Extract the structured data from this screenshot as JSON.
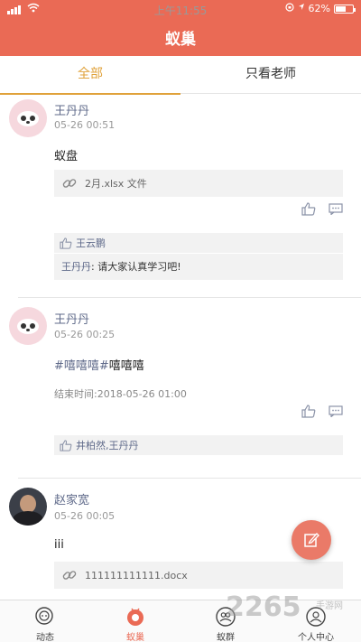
{
  "status_bar": {
    "time": "上午11:55",
    "battery": "62%",
    "battery_level": 0.62
  },
  "header": {
    "title": "蚁巢"
  },
  "tabs": [
    {
      "label": "全部",
      "active": true
    },
    {
      "label": "只看老师",
      "active": false
    }
  ],
  "posts": [
    {
      "author": "王丹丹",
      "time": "05-26 00:51",
      "content": "蚁盘",
      "file": "2月.xlsx 文件",
      "likers": "王云鹏",
      "comment": {
        "author": "王丹丹",
        "sep": ": ",
        "text": "请大家认真学习吧!"
      }
    },
    {
      "author": "王丹丹",
      "time": "05-26 00:25",
      "tag": "#嘻嘻嘻#",
      "content": "嘻嘻嘻",
      "end_time": "结束时间:2018-05-26 01:00",
      "likers": "井柏然,王丹丹"
    },
    {
      "author": "赵家宽",
      "time": "05-26 00:05",
      "content": "iii",
      "file": "111111111111.docx"
    }
  ],
  "bottom_nav": [
    {
      "label": "动态",
      "icon": "chat-bubbles-icon",
      "active": false
    },
    {
      "label": "蚁巢",
      "icon": "nest-icon",
      "active": true
    },
    {
      "label": "蚁群",
      "icon": "group-icon",
      "active": false
    },
    {
      "label": "个人中心",
      "icon": "person-icon",
      "active": false
    }
  ],
  "watermark": {
    "big": "2265",
    "small": "手游网"
  },
  "colors": {
    "accent": "#ea6a55",
    "tab_active": "#e0a23b",
    "name": "#5f6a8a"
  }
}
